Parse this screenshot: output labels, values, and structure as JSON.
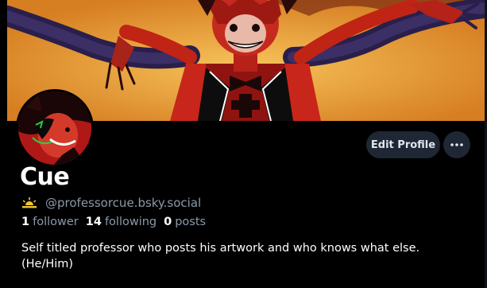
{
  "profile": {
    "display_name": "Cue",
    "handle": "@professorcue.bsky.social",
    "handle_icon": "sun-horizon-icon",
    "bio_line1": "Self titled professor who posts his artwork and who knows what else.",
    "bio_line2": "(He/Him)"
  },
  "stats": {
    "followers_count": "1",
    "followers_label": "follower",
    "following_count": "14",
    "following_label": "following",
    "posts_count": "0",
    "posts_label": "posts"
  },
  "actions": {
    "edit_profile_label": "Edit Profile",
    "more_icon": "ellipsis-icon"
  },
  "colors": {
    "background": "#000000",
    "button_bg": "#1e2733",
    "muted_text": "#8c99a8",
    "handle_icon_color": "#f4c530"
  }
}
